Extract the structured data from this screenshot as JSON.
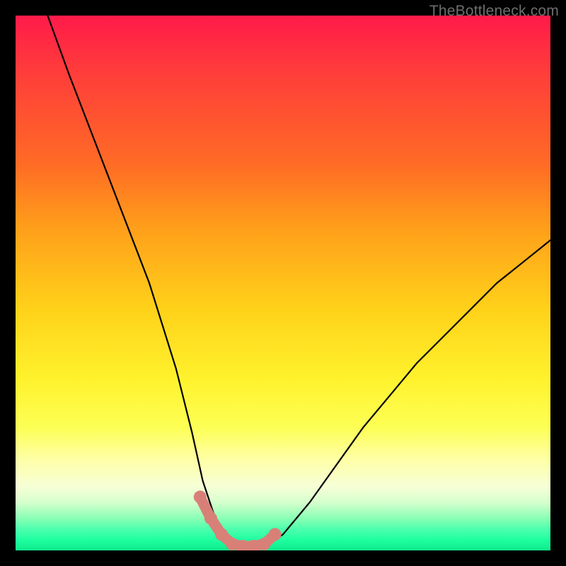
{
  "watermark": "TheBottleneck.com",
  "chart_data": {
    "type": "line",
    "title": "",
    "xlabel": "",
    "ylabel": "",
    "xlim": [
      0,
      100
    ],
    "ylim": [
      0,
      100
    ],
    "series": [
      {
        "name": "curve",
        "x": [
          6,
          10,
          15,
          20,
          25,
          30,
          33,
          35,
          37,
          39,
          41,
          43,
          45,
          47,
          50,
          55,
          60,
          65,
          70,
          75,
          80,
          85,
          90,
          95,
          100
        ],
        "values": [
          100,
          89,
          76,
          63,
          50,
          34,
          22,
          13,
          7,
          3,
          1,
          0.5,
          0.5,
          1,
          3,
          9,
          16,
          23,
          29,
          35,
          40,
          45,
          50,
          54,
          58
        ]
      },
      {
        "name": "highlight-dots",
        "x": [
          34.5,
          36.5,
          38.5,
          40.5,
          42.5,
          44.5,
          46.5,
          48.5
        ],
        "values": [
          10,
          6,
          3,
          1.2,
          0.8,
          0.8,
          1.2,
          3
        ]
      }
    ],
    "colors": {
      "curve": "#000000",
      "dots": "#d88078",
      "gradient_top": "#ff1a4a",
      "gradient_bottom": "#0eea8b"
    }
  }
}
